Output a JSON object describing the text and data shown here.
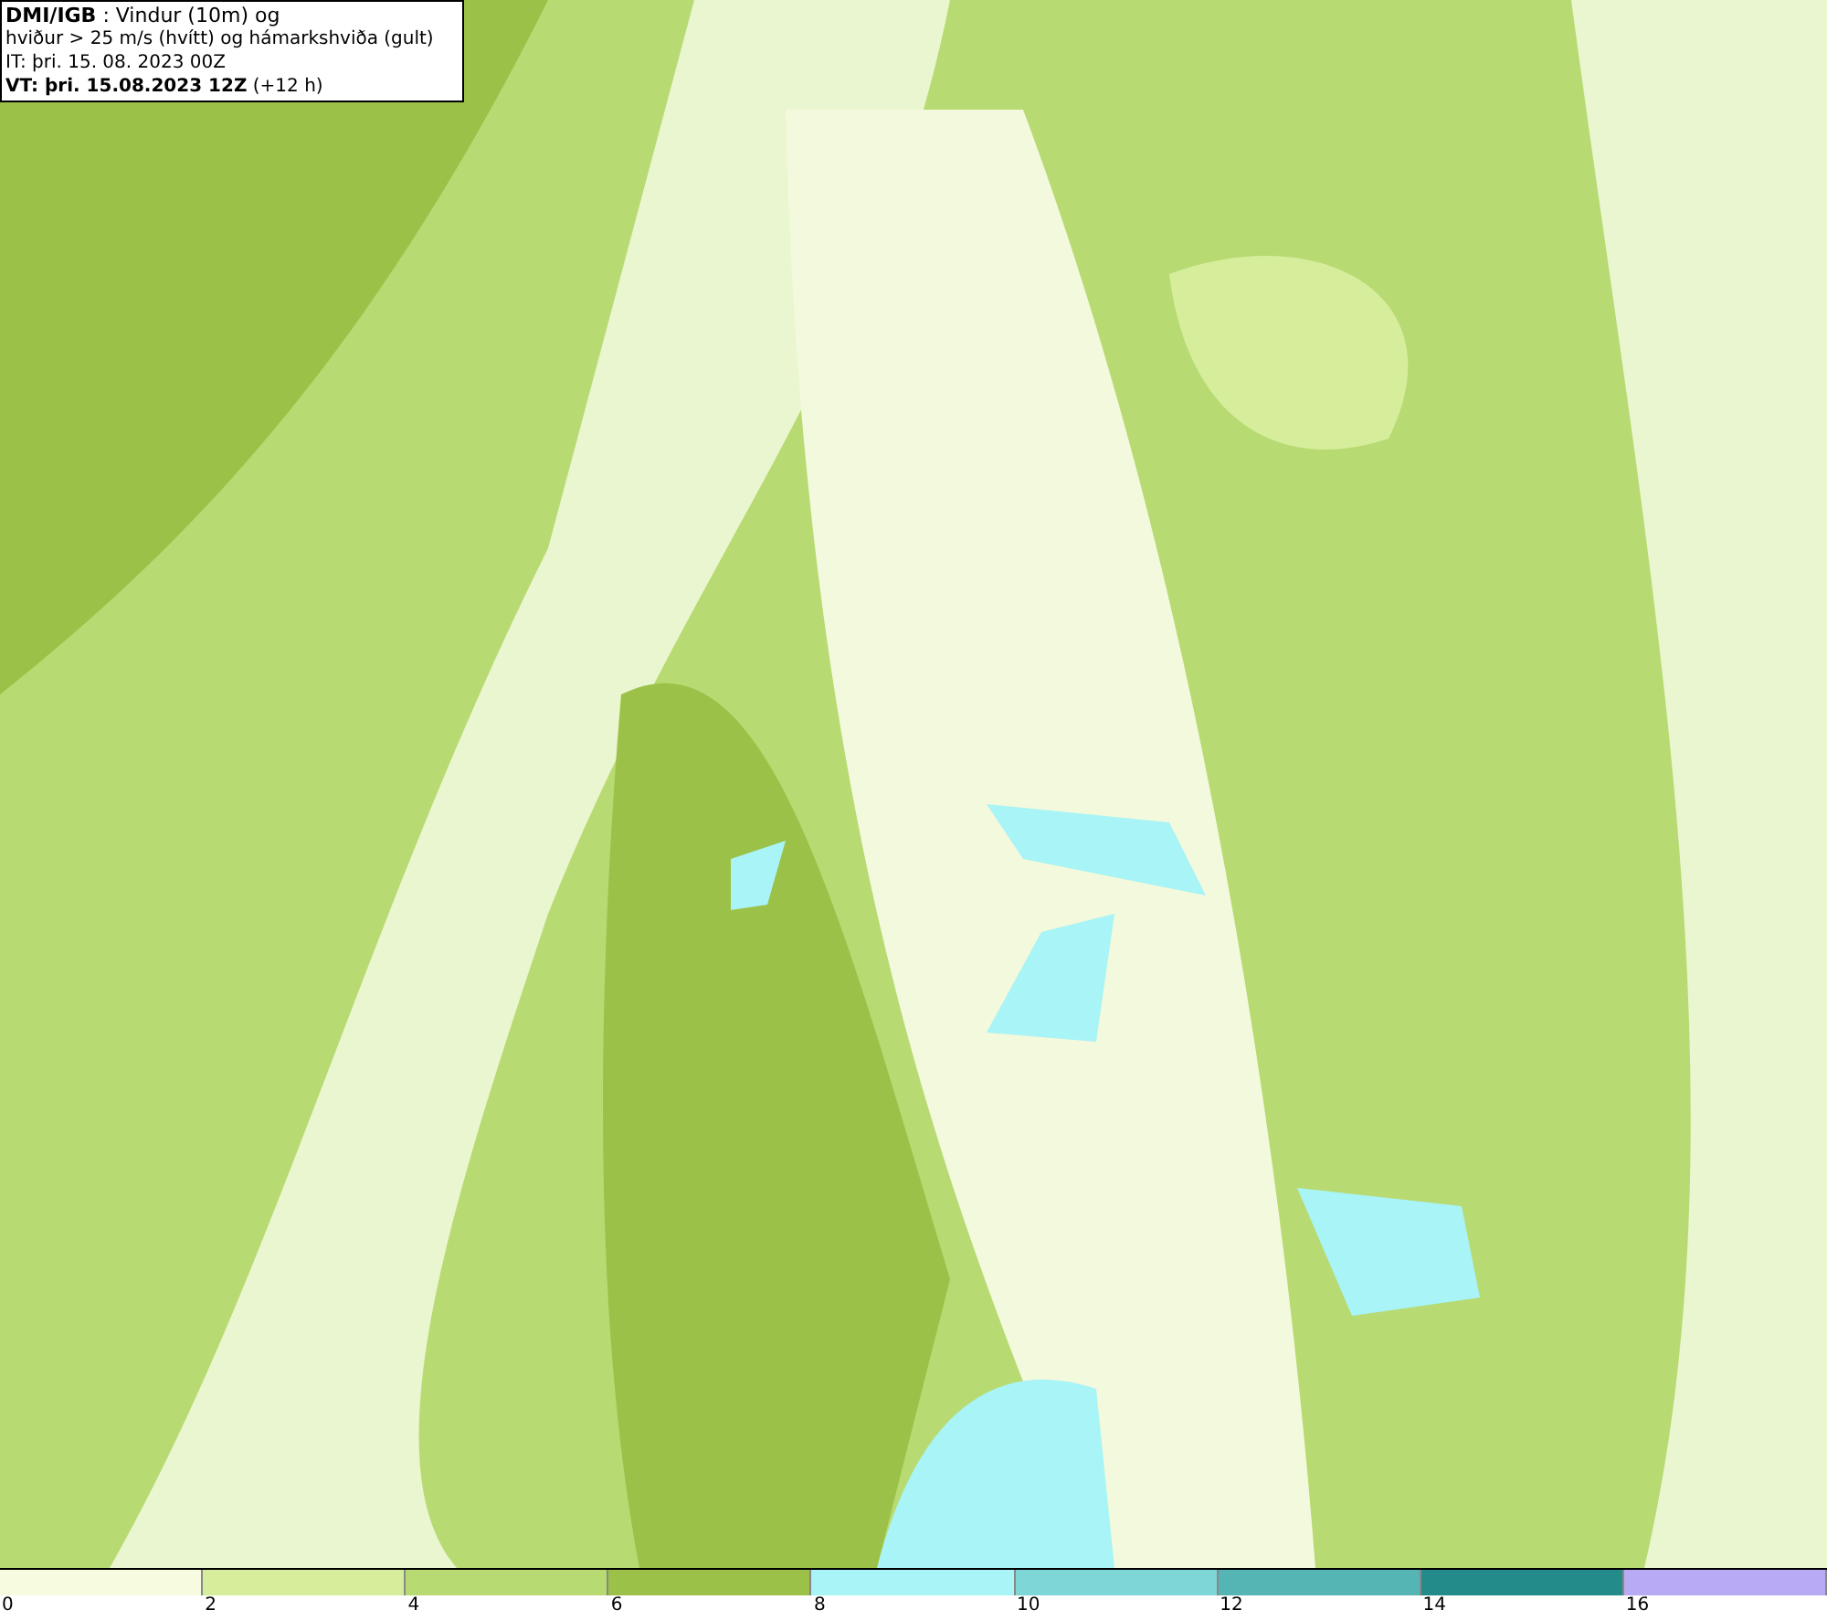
{
  "map": {
    "header": [
      "**DMI/IGB** : Vindur (10m) og",
      "hviður > 25 m/s (hvítt) og hámarkshviða (gult)",
      "IT: þri. 15. 08. 2023 00Z",
      "**VT: þri. 15.08.2023 12Z** (+12 h)"
    ]
  },
  "legend": [
    {
      "color": "#f7fbe0",
      "label": "0"
    },
    {
      "color": "#d6ee9c",
      "label": "2"
    },
    {
      "color": "#b8da72",
      "label": "4"
    },
    {
      "color": "#9cc148",
      "label": "6"
    },
    {
      "color": "#a8f4f7",
      "label": "8"
    },
    {
      "color": "#7fd6d6",
      "label": "10"
    },
    {
      "color": "#55b4b4",
      "label": "12"
    },
    {
      "color": "#238c8a",
      "label": "14"
    },
    {
      "color": "#b9aaf5",
      "label": "16"
    }
  ]
}
